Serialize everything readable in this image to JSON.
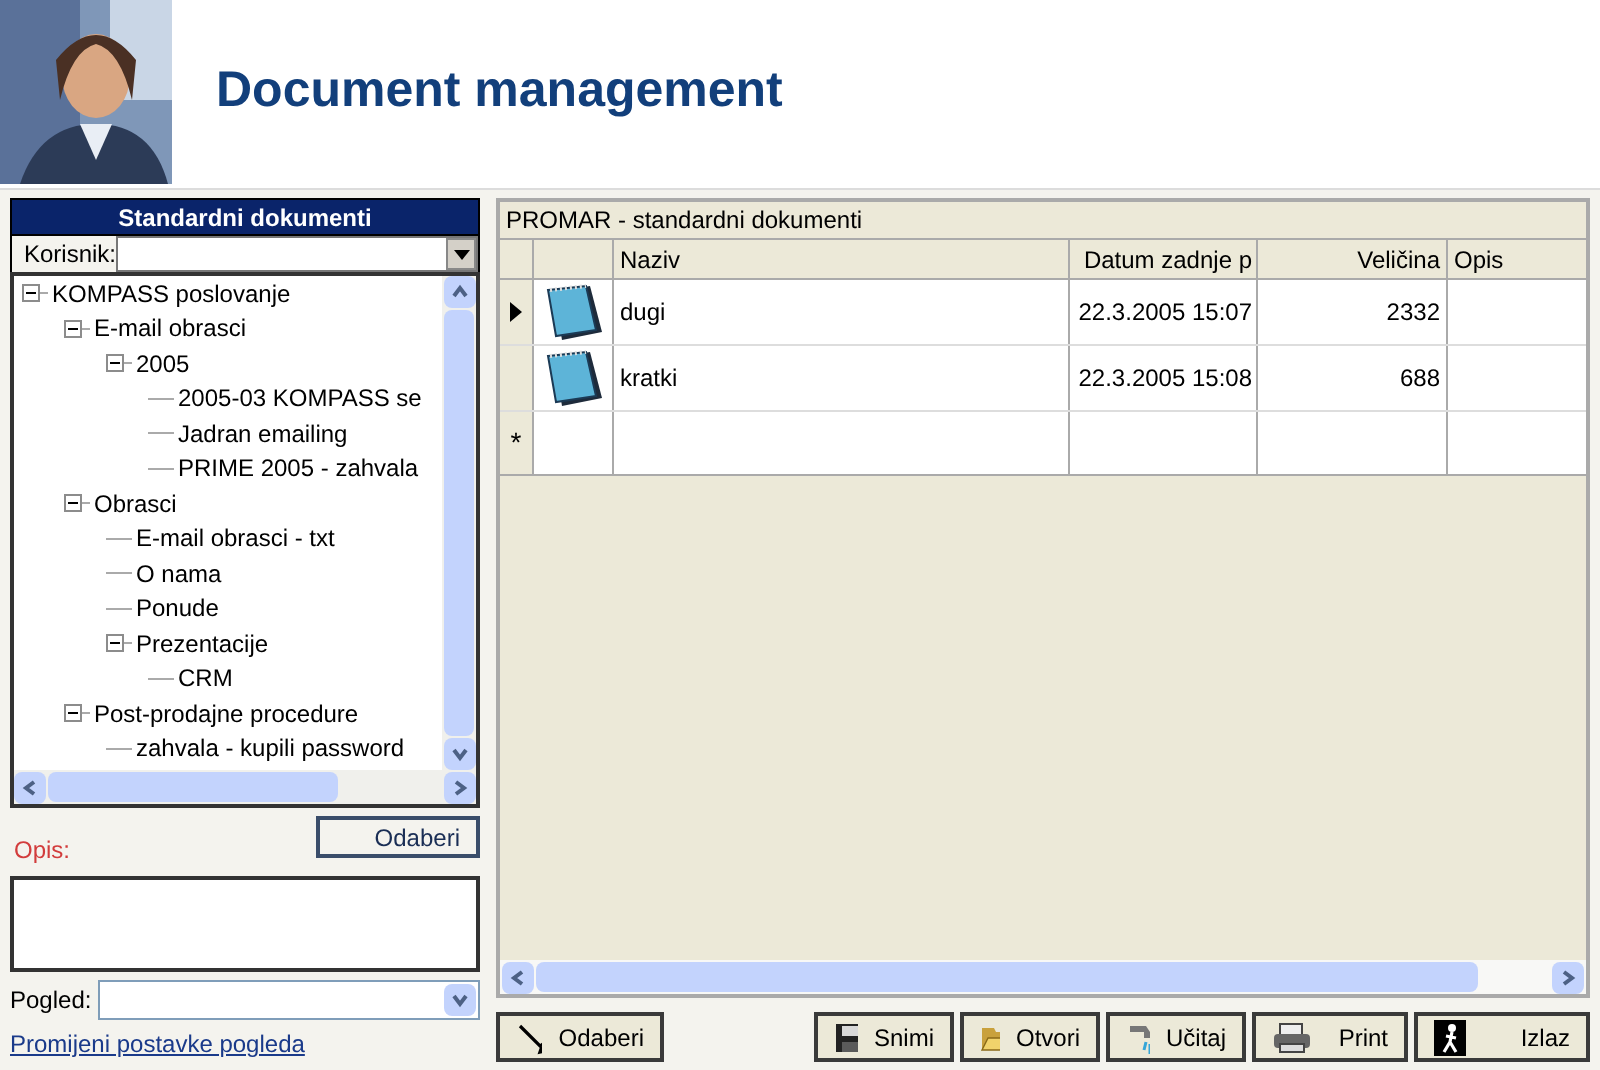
{
  "header": {
    "title": "Document management"
  },
  "left_panel": {
    "title": "Standardni dokumenti",
    "user_field": {
      "label": "Korisnik:"
    },
    "tree": [
      {
        "label": "KOMPASS poslovanje",
        "expanded": true,
        "children": [
          {
            "label": "E-mail obrasci",
            "expanded": true,
            "children": [
              {
                "label": "2005",
                "expanded": true,
                "children": [
                  {
                    "label": "2005-03 KOMPASS se"
                  },
                  {
                    "label": "Jadran emailing"
                  },
                  {
                    "label": "PRIME 2005 - zahvala"
                  }
                ]
              }
            ]
          },
          {
            "label": "Obrasci",
            "expanded": true,
            "children": [
              {
                "label": "E-mail obrasci - txt"
              },
              {
                "label": "O nama"
              },
              {
                "label": "Ponude"
              },
              {
                "label": "Prezentacije",
                "expanded": true,
                "children": [
                  {
                    "label": "CRM"
                  }
                ]
              }
            ]
          },
          {
            "label": "Post-prodajne procedure",
            "expanded": true,
            "children": [
              {
                "label": "zahvala - kupili password"
              }
            ]
          }
        ]
      }
    ],
    "select_button": "Odaberi",
    "description_label": "Opis:",
    "view_field": {
      "label": "Pogled:"
    },
    "view_link": "Promijeni postavke pogleda"
  },
  "grid": {
    "title": "PROMAR - standardni dokumenti",
    "columns": [
      "Naziv",
      "Datum zadnje p",
      "Veličina",
      "Opis"
    ],
    "rows": [
      {
        "name": "dugi",
        "date": "22.3.2005 15:07",
        "size": "2332",
        "selected": true
      },
      {
        "name": "kratki",
        "date": "22.3.2005 15:08",
        "size": "688",
        "selected": false
      }
    ],
    "new_row_marker": "*"
  },
  "toolbar": [
    {
      "kind": "select",
      "label": "Odaberi"
    },
    {
      "kind": "save",
      "label": "Snimi"
    },
    {
      "kind": "open",
      "label": "Otvori"
    },
    {
      "kind": "load",
      "label": "Učitaj"
    },
    {
      "kind": "print",
      "label": "Print"
    },
    {
      "kind": "exit",
      "label": "Izlaz"
    }
  ]
}
